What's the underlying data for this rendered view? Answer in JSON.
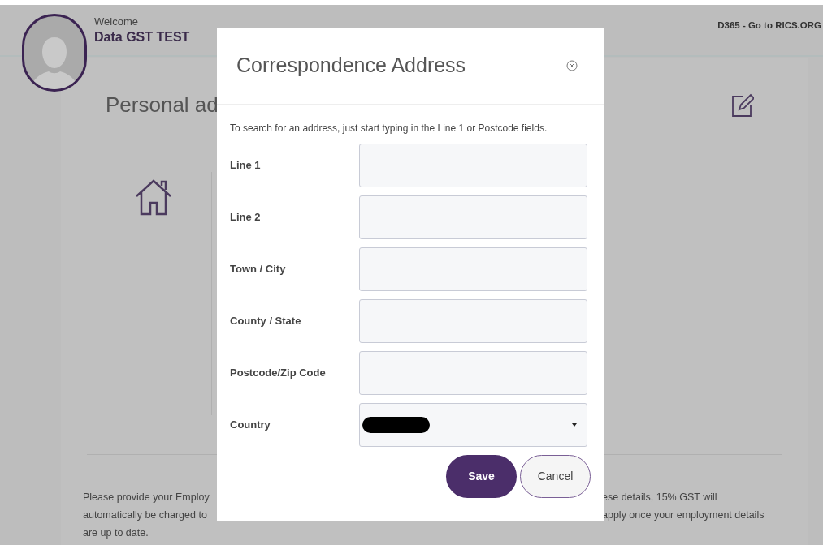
{
  "header": {
    "welcome": "Welcome",
    "user_name": "Data GST TEST",
    "link": "D365 - Go to RICS.ORG"
  },
  "section": {
    "title": "Personal ad"
  },
  "notice": {
    "left_lines": [
      "Please provide your Employ",
      "automatically be charged to",
      "are up to date."
    ],
    "right_lines": [
      "ese details, 15% GST will",
      "apply once your employment details"
    ]
  },
  "dialog": {
    "title": "Correspondence Address",
    "hint": "To search for an address, just start typing in the Line 1 or Postcode fields.",
    "fields": [
      {
        "label": "Line 1",
        "kind": "text"
      },
      {
        "label": "Line 2",
        "kind": "text"
      },
      {
        "label": "Town / City",
        "kind": "text"
      },
      {
        "label": "County / State",
        "kind": "text"
      },
      {
        "label": "Postcode/Zip Code",
        "kind": "text"
      },
      {
        "label": "Country",
        "kind": "select",
        "redacted": true
      }
    ],
    "buttons": [
      {
        "label": "Save",
        "kind": "primary"
      },
      {
        "label": "Cancel",
        "kind": "secondary"
      }
    ]
  }
}
